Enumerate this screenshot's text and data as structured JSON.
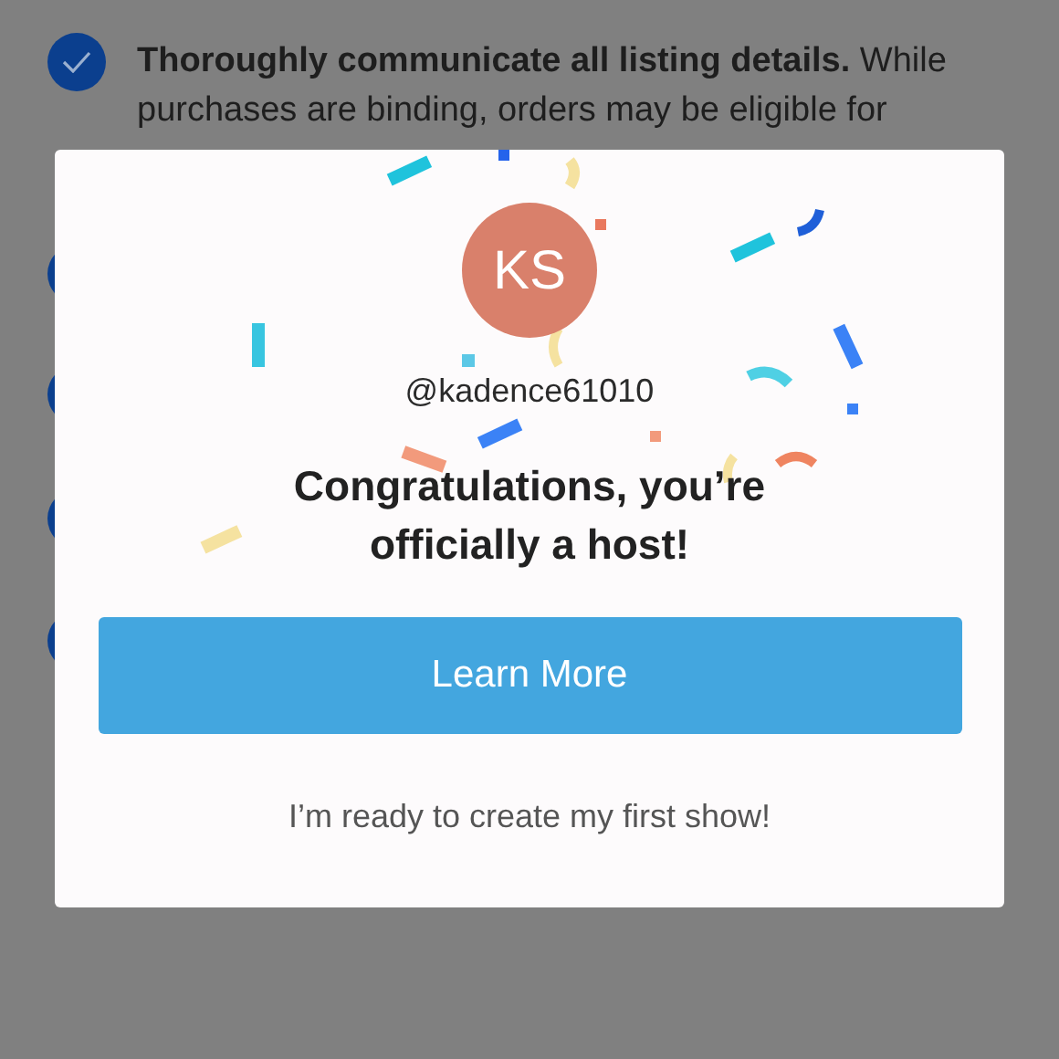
{
  "background_list": [
    {
      "checked": true,
      "text": "**Thoroughly communicate all listing details.** While purchases are binding, orders may be eligible for"
    },
    {
      "checked": true
    },
    {
      "checked": true
    },
    {
      "checked": true
    },
    {
      "checked": true
    }
  ],
  "dialog": {
    "avatar_initials": "KS",
    "username": "@kadence61010",
    "title": "Congratulations, you’re officially a host!",
    "primary_button": "Learn More",
    "secondary_link": "I’m ready to create my first show!"
  }
}
